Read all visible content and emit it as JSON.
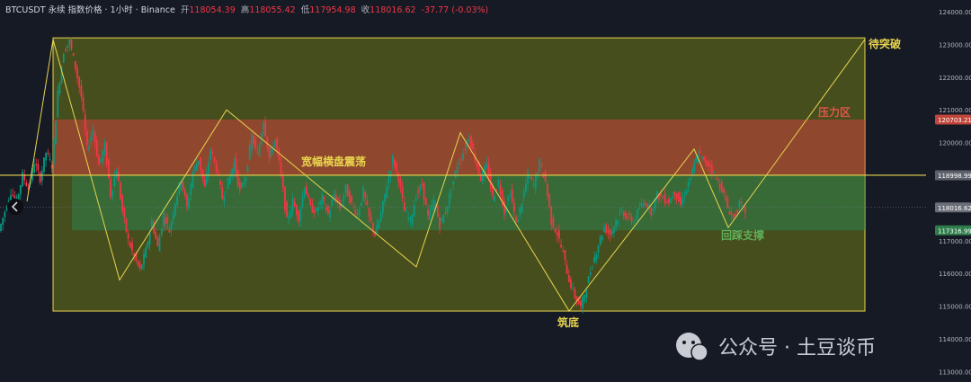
{
  "header": {
    "symbol": "BTCUSDT 永续 指数价格 · 1小时 · Binance",
    "open_label": "开",
    "open": "118054.39",
    "high_label": "高",
    "high": "118055.42",
    "low_label": "低",
    "low": "117954.98",
    "close_label": "收",
    "close": "118016.62",
    "change": "-37.77 (-0.03%)"
  },
  "annotations": {
    "breakout": "待突破",
    "resistance": "压力区",
    "range": "宽幅横盘震荡",
    "bottom": "筑底",
    "support": "回踩支撑"
  },
  "watermark": "公众号 · 土豆谈币",
  "colors": {
    "background": "#161a25",
    "up": "#089981",
    "down": "#f23645",
    "yellow_line": "#e8d44d",
    "resistance_zone": "#c0453a",
    "support_zone": "#2f7d4a",
    "range_box": "#6f7a18"
  },
  "chart_data": {
    "type": "candlestick",
    "timeframe": "1小时",
    "ylim": [
      112600,
      124600
    ],
    "y_ticks": [
      113000,
      114000,
      115000,
      116000,
      117000,
      118000,
      119000,
      120000,
      121000,
      122000,
      123000,
      124000
    ],
    "y_tick_labels": [
      "113000.00",
      "114000.00",
      "115000.00",
      "116000.00",
      "117000.00",
      "118000.00",
      "119000.00",
      "120000.00",
      "121000.00",
      "122000.00",
      "123000.00",
      "124000.00"
    ],
    "price_tags": [
      {
        "label": "120703.21",
        "value": 120703.21,
        "color": "#c0453a"
      },
      {
        "label": "119001.06",
        "value": 119001.06,
        "color": "#e8d44d"
      },
      {
        "label": "118998.99",
        "value": 118998.99,
        "color": "#5d606b"
      },
      {
        "label": "118016.62",
        "value": 118016.62,
        "color": "#6b6e78"
      },
      {
        "label": "117316.99",
        "value": 117316.99,
        "color": "#2f7d4a"
      }
    ],
    "resistance_zone": [
      119001.06,
      120703.21
    ],
    "support_zone": [
      117316.99,
      119001.06
    ],
    "range_box": [
      114850,
      123200
    ],
    "horizontal_line": 119001.06,
    "zigzag": [
      118200,
      123150,
      115800,
      121000,
      116200,
      120300,
      114850,
      119800,
      117400,
      123150
    ],
    "series": [
      {
        "price_path": [
          117300,
          117900,
          118500,
          118200,
          119000,
          118600,
          119400,
          118900,
          119700,
          119300,
          121500,
          122800,
          123100,
          122300,
          121400,
          119800,
          120400,
          119300,
          119900,
          118400,
          119200,
          117900,
          117000,
          116500,
          116100,
          116700,
          117600,
          116800,
          117800,
          117300,
          118200,
          118900,
          118000,
          119100,
          119500,
          118600,
          119800,
          119200,
          118300,
          118800,
          119400,
          118500,
          119000,
          120200,
          119600,
          120700,
          119500,
          120100,
          119000,
          117600,
          118200,
          117700,
          118700,
          118000,
          117900,
          118300,
          117800,
          118400,
          118000,
          118600,
          118100,
          117800,
          118500,
          117700,
          117200,
          117800,
          118700,
          119500,
          118900,
          117900,
          117600,
          118400,
          118700,
          117700,
          118200,
          117500,
          117900,
          118600,
          119300,
          119700,
          120200,
          119500,
          118900,
          119300,
          118300,
          118800,
          117900,
          118500,
          117500,
          118200,
          119000,
          118700,
          119400,
          118800,
          117600,
          117200,
          116600,
          115800,
          115300,
          114950,
          115600,
          116300,
          116900,
          117400,
          117200,
          117600,
          117900,
          117700,
          117600,
          118000,
          118200,
          117900,
          118400,
          118300,
          118200,
          118500,
          118100,
          118600,
          119100,
          119700,
          119400,
          119300,
          118900,
          118600,
          118000,
          117700,
          118100,
          117900
        ]
      }
    ]
  }
}
